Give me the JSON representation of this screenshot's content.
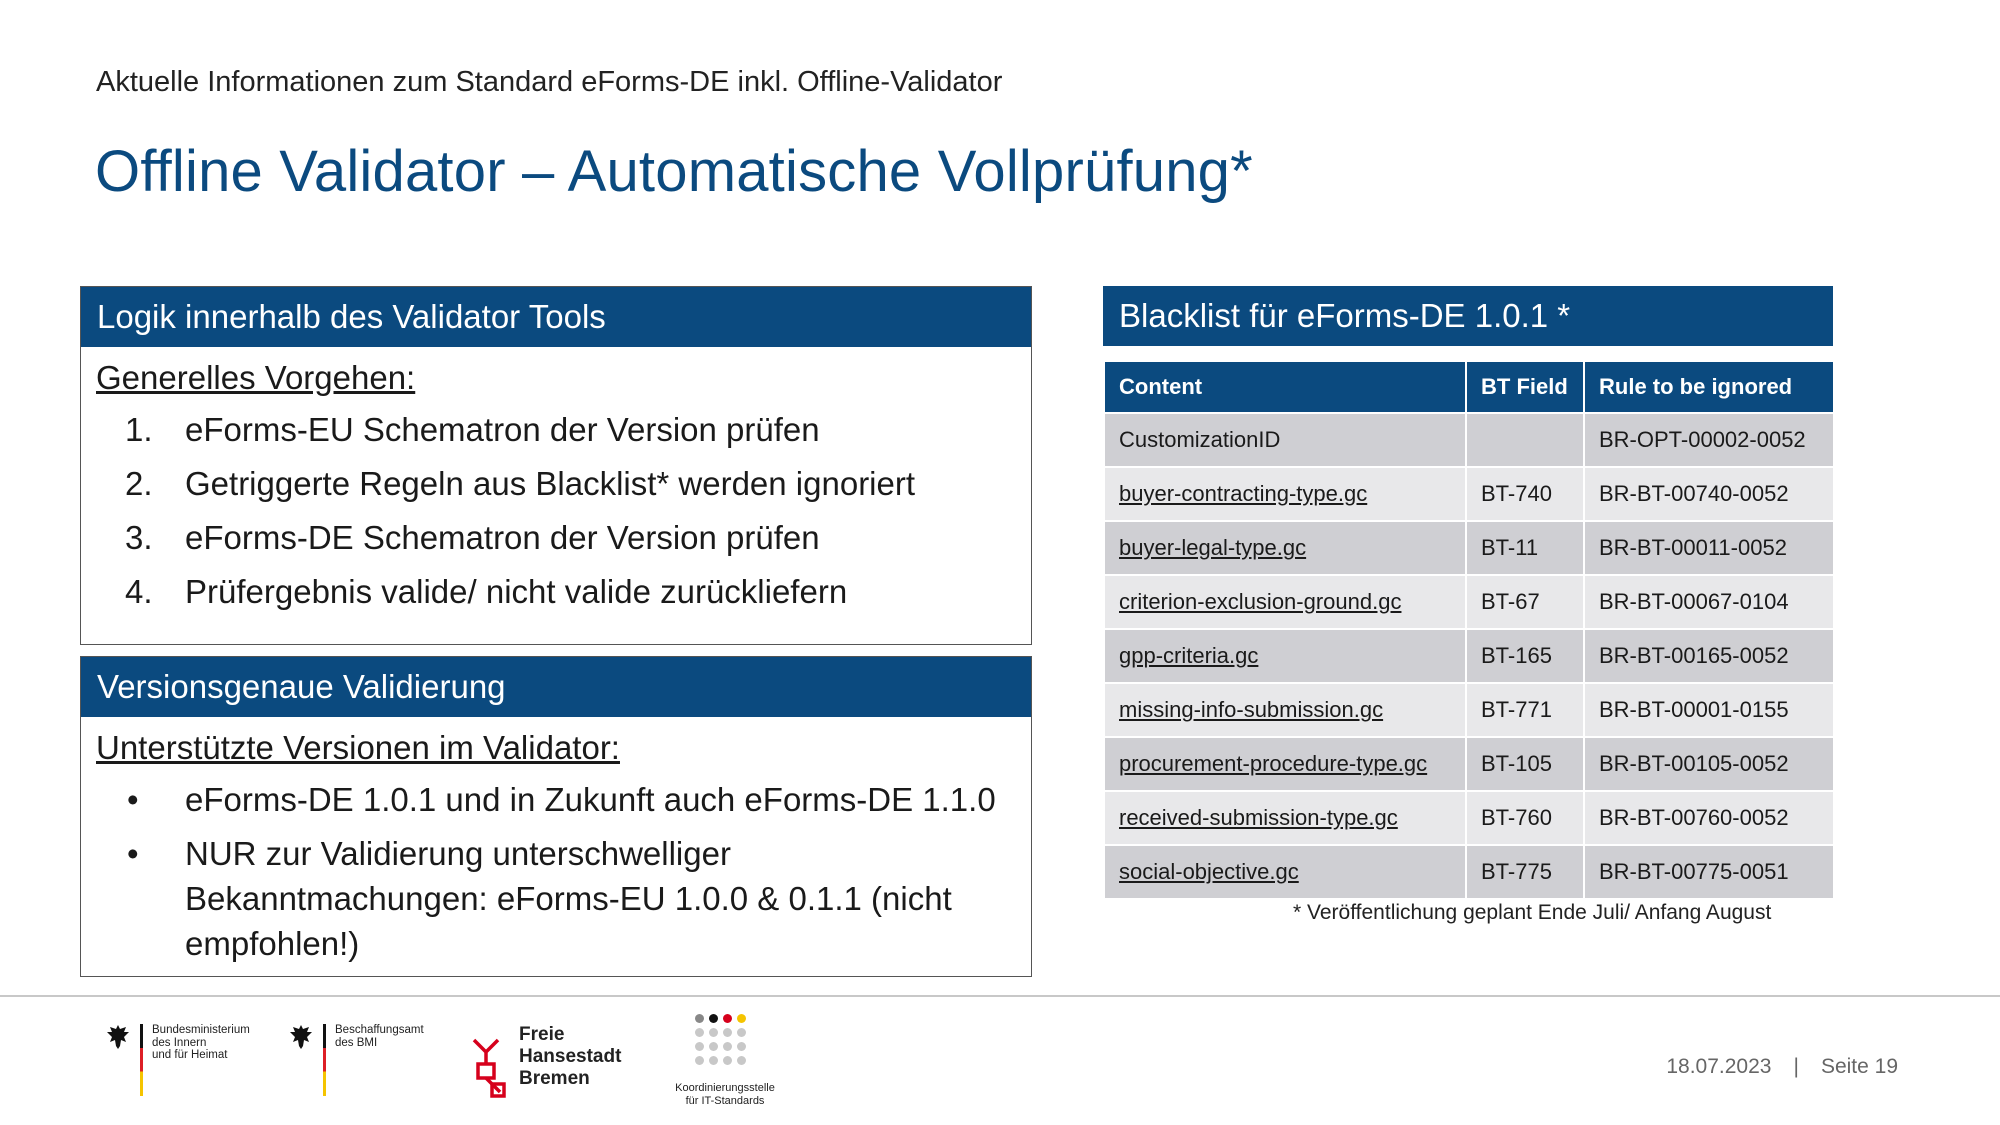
{
  "header": {
    "subtitle": "Aktuelle Informationen zum Standard eForms-DE inkl. Offline-Validator",
    "title": "Offline Validator – Automatische Vollprüfung*"
  },
  "logic_box": {
    "heading": "Logik innerhalb des Validator Tools",
    "label": "Generelles Vorgehen:",
    "steps": [
      {
        "num": "1.",
        "text": "eForms-EU Schematron der Version prüfen"
      },
      {
        "num": "2.",
        "text": "Getriggerte Regeln aus Blacklist* werden ignoriert"
      },
      {
        "num": "3.",
        "text": "eForms-DE Schematron der Version prüfen"
      },
      {
        "num": "4.",
        "text": "Prüfergebnis valide/ nicht valide zurückliefern"
      }
    ]
  },
  "version_box": {
    "heading": "Versionsgenaue Validierung",
    "label": "Unterstützte Versionen im Validator:",
    "items": [
      {
        "bullet": "•",
        "text": "eForms-DE 1.0.1 und in Zukunft auch eForms-DE 1.1.0"
      },
      {
        "bullet": "•",
        "text": "NUR zur Validierung unterschwelliger Bekanntmachungen: eForms-EU 1.0.0 & 0.1.1 (nicht empfohlen!)"
      }
    ]
  },
  "blacklist": {
    "heading": "Blacklist für eForms-DE 1.0.1 *",
    "columns": [
      "Content",
      "BT Field",
      "Rule to be ignored"
    ],
    "rows": [
      [
        "CustomizationID",
        "",
        "BR-OPT-00002-0052"
      ],
      [
        "buyer-contracting-type.gc",
        "BT-740",
        "BR-BT-00740-0052"
      ],
      [
        "buyer-legal-type.gc",
        "BT-11",
        "BR-BT-00011-0052"
      ],
      [
        "criterion-exclusion-ground.gc",
        "BT-67",
        "BR-BT-00067-0104"
      ],
      [
        "gpp-criteria.gc",
        "BT-165",
        "BR-BT-00165-0052"
      ],
      [
        "missing-info-submission.gc",
        "BT-771",
        "BR-BT-00001-0155"
      ],
      [
        "procurement-procedure-type.gc",
        "BT-105",
        "BR-BT-00105-0052"
      ],
      [
        "received-submission-type.gc",
        "BT-760",
        "BR-BT-00760-0052"
      ],
      [
        "social-objective.gc",
        "BT-775",
        "BR-BT-00775-0051"
      ]
    ],
    "footnote": "* Veröffentlichung geplant Ende Juli/ Anfang August"
  },
  "footer": {
    "logo_bmi": "Bundesministerium\ndes Innern\nund für Heimat",
    "logo_bescha": "Beschaffungsamt\ndes BMI",
    "logo_bremen": "Freie\nHansestadt\nBremen",
    "logo_kosit": "Koordinierungsstelle\nfür IT-Standards",
    "date": "18.07.2023",
    "separator": "|",
    "page": "Seite 19"
  },
  "colors": {
    "brand_blue": "#0b4a7f",
    "row_dark": "#cfcfd3",
    "row_light": "#e8e8ea"
  }
}
